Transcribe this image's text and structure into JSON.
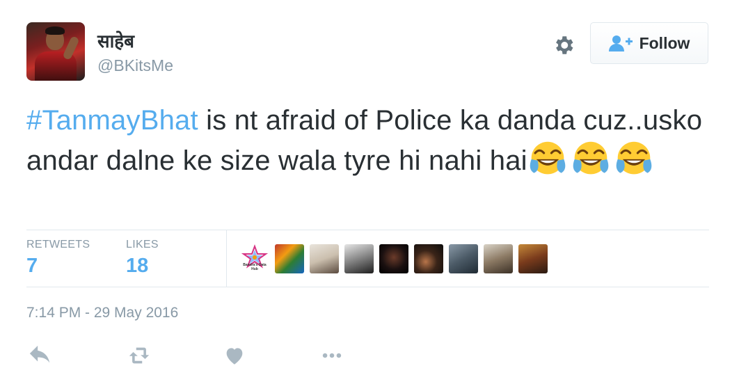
{
  "user": {
    "display_name": "साहेब",
    "handle": "@BKitsMe"
  },
  "header": {
    "follow_label": "Follow"
  },
  "tweet": {
    "hashtag": "#TanmayBhat",
    "text": " is nt afraid of Police ka danda cuz..usko  andar dalne ke size wala tyre hi nahi hai",
    "emoji_count": 3,
    "emoji_name": "face-with-tears-of-joy"
  },
  "stats": {
    "retweets_label": "RETWEETS",
    "retweets_count": "7",
    "likes_label": "LIKES",
    "likes_count": "18"
  },
  "likers": {
    "first_logo_text": "Bandra's Data Hub",
    "count": 9
  },
  "timestamp": "7:14 PM - 29 May 2016",
  "actions": [
    "reply-icon",
    "retweet-icon",
    "like-icon",
    "more-icon"
  ],
  "colors": {
    "link": "#55acee",
    "text": "#292f33",
    "muted": "#8899a6",
    "border": "#e1e8ed"
  }
}
